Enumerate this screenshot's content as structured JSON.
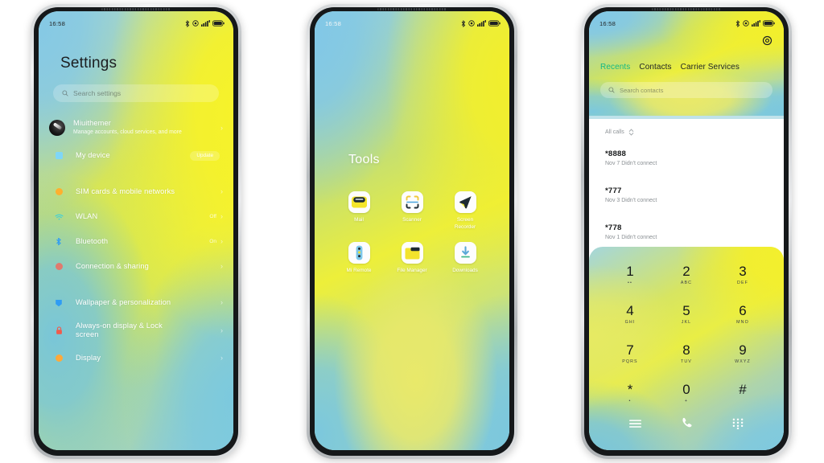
{
  "background_color": "#ffffff",
  "accent": {
    "active_tab": "#12b887",
    "wallpaper_yellow": "#f0ee2e",
    "wallpaper_blue": "#86c9e4",
    "frame_silver": "#cfd2d4"
  },
  "phones": [
    {
      "id": "settings-phone",
      "status_bar": {
        "clock": "16:58",
        "icons": [
          "bluetooth-icon",
          "dnd-icon",
          "signal-bars-icon",
          "battery-icon"
        ]
      },
      "app": {
        "title": "Settings",
        "search": {
          "placeholder": "Search settings",
          "icon": "search-icon"
        },
        "account": {
          "name": "Miuithemer",
          "subtitle": "Manage accounts, cloud services, and more",
          "avatar": "user-avatar"
        },
        "items": [
          {
            "label": "My device",
            "icon": "device-icon",
            "icon_color": "#7fd6f7",
            "badge": "Update",
            "value": ""
          },
          {
            "label": "SIM cards & mobile networks",
            "icon": "sim-icon",
            "icon_color": "#ffb02e",
            "value": "",
            "badge": ""
          },
          {
            "label": "WLAN",
            "icon": "wifi-icon",
            "icon_color": "#3fd0d8",
            "value": "Off",
            "badge": ""
          },
          {
            "label": "Bluetooth",
            "icon": "bluetooth-icon",
            "icon_color": "#2f9cf4",
            "value": "On",
            "badge": ""
          },
          {
            "label": "Connection & sharing",
            "icon": "connection-icon",
            "icon_color": "#e07a6e",
            "value": "",
            "badge": ""
          },
          {
            "label": "Wallpaper & personalization",
            "icon": "wallpaper-icon",
            "icon_color": "#2f9cf4",
            "value": "",
            "badge": ""
          },
          {
            "label": "Always-on display & Lock screen",
            "icon": "lock-icon",
            "icon_color": "#f05a4c",
            "value": "",
            "badge": ""
          },
          {
            "label": "Display",
            "icon": "display-icon",
            "icon_color": "#ffa93a",
            "value": "",
            "badge": ""
          }
        ],
        "chevron": "›"
      }
    },
    {
      "id": "folder-phone",
      "status_bar": {
        "clock": "16:58",
        "icons": [
          "bluetooth-icon",
          "dnd-icon",
          "signal-bars-icon",
          "battery-icon"
        ]
      },
      "app": {
        "folder_title": "Tools",
        "apps": [
          {
            "label": "Mail",
            "icon": "mail-icon"
          },
          {
            "label": "Scanner",
            "icon": "scanner-icon"
          },
          {
            "label": "Screen Recorder",
            "icon": "screen-recorder-icon"
          },
          {
            "label": "Mi Remote",
            "icon": "mi-remote-icon"
          },
          {
            "label": "File Manager",
            "icon": "file-manager-icon"
          },
          {
            "label": "Downloads",
            "icon": "downloads-icon"
          }
        ]
      }
    },
    {
      "id": "dialer-phone",
      "status_bar": {
        "clock": "16:58",
        "icons": [
          "bluetooth-icon",
          "dnd-icon",
          "signal-bars-icon",
          "battery-icon"
        ]
      },
      "app": {
        "settings_icon": "gear-icon",
        "tabs": [
          {
            "label": "Recents",
            "active": true
          },
          {
            "label": "Contacts",
            "active": false
          },
          {
            "label": "Carrier Services",
            "active": false
          }
        ],
        "search": {
          "placeholder": "Search contacts",
          "icon": "search-icon"
        },
        "filter": {
          "label": "All calls",
          "icon": "sort-chevrons-icon"
        },
        "calls": [
          {
            "number": "*8888",
            "meta": "Nov 7 Didn't connect"
          },
          {
            "number": "*777",
            "meta": "Nov 3 Didn't connect"
          },
          {
            "number": "*778",
            "meta": "Nov 1 Didn't connect"
          }
        ],
        "dialpad": [
          {
            "digit": "1",
            "letters": "••"
          },
          {
            "digit": "2",
            "letters": "ABC"
          },
          {
            "digit": "3",
            "letters": "DEF"
          },
          {
            "digit": "4",
            "letters": "GHI"
          },
          {
            "digit": "5",
            "letters": "JKL"
          },
          {
            "digit": "6",
            "letters": "MNO"
          },
          {
            "digit": "7",
            "letters": "PQRS"
          },
          {
            "digit": "8",
            "letters": "TUV"
          },
          {
            "digit": "9",
            "letters": "WXYZ"
          },
          {
            "digit": "*",
            "letters": "•"
          },
          {
            "digit": "0",
            "letters": "+"
          },
          {
            "digit": "#",
            "letters": ""
          }
        ],
        "bottom_nav": [
          {
            "icon": "menu-icon"
          },
          {
            "icon": "call-icon"
          },
          {
            "icon": "keypad-icon"
          }
        ]
      }
    }
  ]
}
